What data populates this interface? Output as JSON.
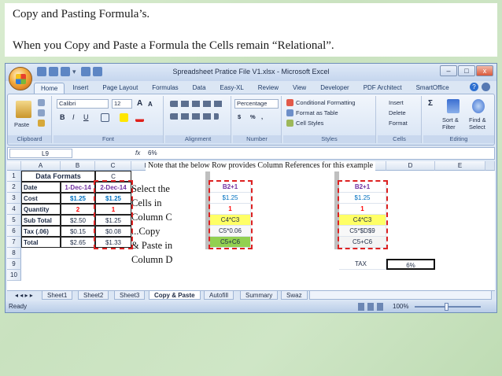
{
  "slide": {
    "title": "Copy and Pasting Formula’s.",
    "subtitle": "When you Copy and Paste a Formula the Cells remain “Relational”."
  },
  "window": {
    "title": "Spreadsheet Pratice File V1.xlsx - Microsoft Excel",
    "controls": [
      "–",
      "□",
      "x"
    ]
  },
  "ribbon_tabs": [
    "Home",
    "Insert",
    "Page Layout",
    "Formulas",
    "Data",
    "Easy-XL",
    "Review",
    "View",
    "Developer",
    "PDF Architect",
    "SmartOffice"
  ],
  "ribbon": {
    "clipboard": {
      "label": "Clipboard",
      "paste": "Paste"
    },
    "font": {
      "label": "Font",
      "name": "Calibri",
      "size": "12",
      "bold": "B",
      "italic": "I",
      "underline": "U",
      "grow": "A",
      "shrink": "A"
    },
    "alignment": {
      "label": "Alignment"
    },
    "number": {
      "label": "Number",
      "format": "Percentage",
      "currency": "$",
      "percent": "%",
      "comma": ","
    },
    "styles": {
      "label": "Styles",
      "cond": "Conditional Formatting",
      "table": "Format as Table",
      "cell": "Cell Styles"
    },
    "cells": {
      "label": "Cells",
      "insert": "Insert",
      "delete": "Delete",
      "format": "Format"
    },
    "editing": {
      "label": "Editing",
      "sum": "Σ",
      "sort": "Sort & Filter",
      "find": "Find & Select"
    }
  },
  "formula_bar": {
    "name_box": "L9",
    "fx": "fx",
    "value": "6%"
  },
  "columns_left": [
    "A",
    "B",
    "C",
    "D",
    "E"
  ],
  "columns_mid": [
    "C",
    "D",
    "E"
  ],
  "columns_right": [
    "C",
    "D",
    "E"
  ],
  "rows": [
    "1",
    "2",
    "3",
    "4",
    "5",
    "6",
    "7",
    "8",
    "9",
    "10"
  ],
  "table": {
    "header": "Data Formats",
    "c1": "C",
    "labels": [
      "Date",
      "Cost",
      "Quantity",
      "Sub Total",
      "Tax (.06)",
      "Total"
    ],
    "colB": [
      "1-Dec-14",
      "$1.25",
      "2",
      "$2.50",
      "$0.15",
      "$2.65"
    ],
    "colC": [
      "2-Dec-14",
      "$1.25",
      "1",
      "$1.25",
      "$0.08",
      "$1.33"
    ]
  },
  "formulas_mid": [
    "B2+1",
    "$1.25",
    "1",
    "C4*C3",
    "C5*0.06",
    "C5+C6"
  ],
  "formulas_right": [
    "B2+1",
    "$1.25",
    "1",
    "C4*C3",
    "C5*$D$9",
    "C5+C6"
  ],
  "tax": {
    "label": "TAX",
    "value": "6%"
  },
  "note": "Note that the below Row provides Column References for this example",
  "instructions": [
    "Select the",
    "Cells in",
    "Column C",
    "...Copy",
    "& Paste in",
    "Column D"
  ],
  "sheet_tabs": [
    "Sheet1",
    "Sheet2",
    "Sheet3",
    "Copy & Paste",
    "Autofill",
    "Summary",
    "Swaz"
  ],
  "status": {
    "ready": "Ready",
    "zoom": "100%"
  },
  "colors": {
    "accent": "#d22222",
    "date_purple": "#7030a0",
    "cost_blue": "#0070c0",
    "qty_red": "#ff0000",
    "yellow": "#ffff66",
    "green": "#92d050"
  }
}
